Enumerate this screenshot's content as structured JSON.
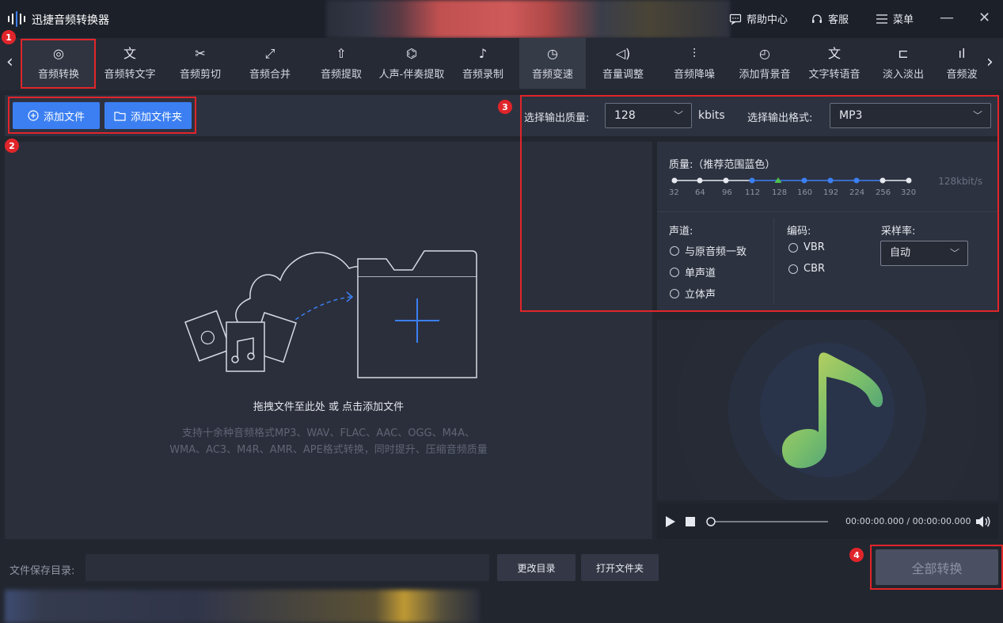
{
  "app": {
    "title": "迅捷音频转换器"
  },
  "window": {
    "help_label": "帮助中心",
    "service_label": "客服",
    "menu_label": "菜单",
    "minimize": "—",
    "close": "✕"
  },
  "nav": {
    "prev": "‹",
    "next": "›"
  },
  "tools": [
    {
      "icon": "audio-convert-icon",
      "glyph": "◎",
      "label": "音频转换"
    },
    {
      "icon": "speech-to-text-icon",
      "glyph": "文",
      "label": "音频转文字"
    },
    {
      "icon": "scissors-icon",
      "glyph": "✂",
      "label": "音频剪切"
    },
    {
      "icon": "merge-icon",
      "glyph": "⤢",
      "label": "音频合并"
    },
    {
      "icon": "extract-icon",
      "glyph": "⇧",
      "label": "音频提取"
    },
    {
      "icon": "vocal-extract-icon",
      "glyph": "⌬",
      "label": "人声-伴奏提取"
    },
    {
      "icon": "microphone-icon",
      "glyph": "♪",
      "label": "音频录制"
    },
    {
      "icon": "speed-icon",
      "glyph": "◷",
      "label": "音频变速"
    },
    {
      "icon": "volume-icon",
      "glyph": "◁)",
      "label": "音量调整"
    },
    {
      "icon": "denoise-icon",
      "glyph": "⫶",
      "label": "音频降噪"
    },
    {
      "icon": "bgm-icon",
      "glyph": "◴",
      "label": "添加背景音"
    },
    {
      "icon": "text-to-speech-icon",
      "glyph": "文",
      "label": "文字转语音"
    },
    {
      "icon": "fade-icon",
      "glyph": "⊏",
      "label": "淡入淡出"
    },
    {
      "icon": "audio-more-icon",
      "glyph": "ıl",
      "label": "音频波"
    }
  ],
  "actions": {
    "add_file": "添加文件",
    "add_folder": "添加文件夹"
  },
  "output": {
    "quality_label": "选择输出质量:",
    "quality_value": "128",
    "quality_unit": "kbits",
    "format_label": "选择输出格式:",
    "format_value": "MP3"
  },
  "quality_panel": {
    "title": "质量:（推荐范围蓝色）",
    "ticks": [
      "32",
      "64",
      "96",
      "112",
      "128",
      "160",
      "192",
      "224",
      "256",
      "320"
    ],
    "selected": "128kbit/s",
    "channel_title": "声道:",
    "channel_options": [
      "与原音频一致",
      "单声道",
      "立体声"
    ],
    "encoding_title": "编码:",
    "encoding_options": [
      "VBR",
      "CBR"
    ],
    "sample_title": "采样率:",
    "sample_value": "自动"
  },
  "dropzone": {
    "main_text": "拖拽文件至此处 或 点击添加文件",
    "sub_line1": "支持十余种音频格式MP3、WAV、FLAC、AAC、OGG、M4A、",
    "sub_line2": "WMA、AC3、M4R、AMR、APE格式转换，同时提升、压缩音频质量"
  },
  "player": {
    "time": "00:00:00.000 / 00:00:00.000"
  },
  "bottom": {
    "save_label": "文件保存目录:",
    "change_dir": "更改目录",
    "open_folder": "打开文件夹",
    "convert_all": "全部转换"
  },
  "annotations": [
    "1",
    "2",
    "3",
    "4"
  ],
  "colors": {
    "accent": "#3b7ff2",
    "annotation": "#e0252a",
    "note_gradient_start": "#c9d45a",
    "note_gradient_end": "#2e8e82"
  }
}
